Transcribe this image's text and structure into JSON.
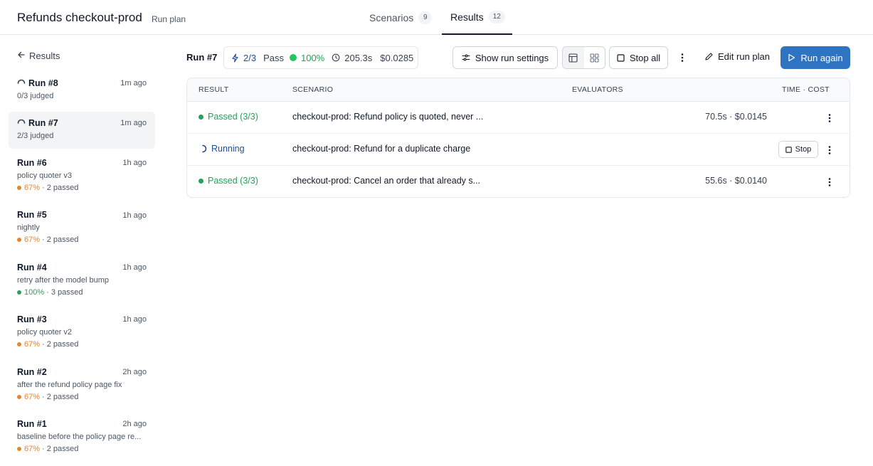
{
  "header": {
    "title": "Refunds checkout-prod",
    "subtitle": "Run plan",
    "tabs": [
      {
        "label": "Scenarios",
        "count": "9"
      },
      {
        "label": "Results",
        "count": "12"
      }
    ]
  },
  "sidebar": {
    "back_label": "Results",
    "runs": [
      {
        "title": "Run #8",
        "time": "1m ago",
        "subtitle": "0/3 judged",
        "status": "running"
      },
      {
        "title": "Run #7",
        "time": "1m ago",
        "subtitle": "2/3 judged",
        "status": "running",
        "selected": true
      },
      {
        "title": "Run #6",
        "time": "1h ago",
        "subtitle": "policy quoter v3",
        "pct": "67%",
        "passed": "· 2 passed",
        "color": "#e8842c"
      },
      {
        "title": "Run #5",
        "time": "1h ago",
        "subtitle": "nightly",
        "pct": "67%",
        "passed": "· 2 passed",
        "color": "#e8842c"
      },
      {
        "title": "Run #4",
        "time": "1h ago",
        "subtitle": "retry after the model bump",
        "pct": "100%",
        "passed": "· 3 passed",
        "color": "#2f9e5b"
      },
      {
        "title": "Run #3",
        "time": "1h ago",
        "subtitle": "policy quoter v2",
        "pct": "67%",
        "passed": "· 2 passed",
        "color": "#e8842c"
      },
      {
        "title": "Run #2",
        "time": "2h ago",
        "subtitle": "after the refund policy page fix",
        "pct": "67%",
        "passed": "· 2 passed",
        "color": "#e8842c"
      },
      {
        "title": "Run #1",
        "time": "2h ago",
        "subtitle": "baseline before the policy page re...",
        "pct": "67%",
        "passed": "· 2 passed",
        "color": "#e8842c"
      }
    ]
  },
  "toolbar": {
    "run_label": "Run #7",
    "judged": "2/3",
    "pass_label": "Pass",
    "pass_pct": "100%",
    "duration": "205.3s",
    "cost": "$0.0285",
    "show_settings": "Show run settings",
    "stop_all": "Stop all",
    "edit_plan": "Edit run plan",
    "run_again": "Run again"
  },
  "table": {
    "columns": [
      "RESULT",
      "SCENARIO",
      "EVALUATORS",
      "TIME · COST"
    ],
    "rows": [
      {
        "result": "Passed (3/3)",
        "status": "passed",
        "scenario": "checkout-prod: Refund policy is quoted, never ...",
        "time_cost": "70.5s · $0.0145"
      },
      {
        "result": "Running",
        "status": "running",
        "scenario": "checkout-prod: Refund for a duplicate charge",
        "time_cost": "",
        "stop_label": "Stop"
      },
      {
        "result": "Passed (3/3)",
        "status": "passed",
        "scenario": "checkout-prod: Cancel an order that already s...",
        "time_cost": "55.6s · $0.0140"
      }
    ]
  },
  "colors": {
    "accent": "#2f74c0",
    "pass_green": "#22a35a",
    "warn_orange": "#e8842c",
    "running_blue": "#1f4e8c"
  }
}
